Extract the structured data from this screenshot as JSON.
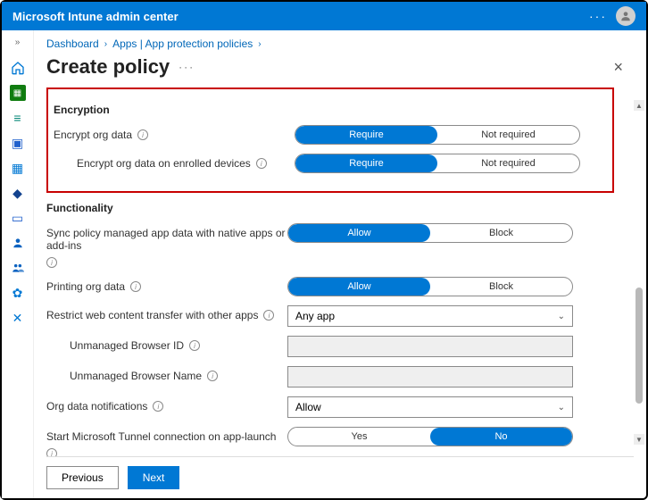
{
  "titlebar": {
    "title": "Microsoft Intune admin center"
  },
  "breadcrumbs": {
    "items": [
      "Dashboard",
      "Apps | App protection policies"
    ]
  },
  "page": {
    "title": "Create policy"
  },
  "sections": {
    "encryption": {
      "title": "Encryption",
      "encrypt_org": {
        "label": "Encrypt org data",
        "opt_on": "Require",
        "opt_off": "Not required"
      },
      "encrypt_enrolled": {
        "label": "Encrypt org data on enrolled devices",
        "opt_on": "Require",
        "opt_off": "Not required"
      }
    },
    "functionality": {
      "title": "Functionality",
      "sync": {
        "label": "Sync policy managed app data with native apps or add-ins",
        "opt_on": "Allow",
        "opt_off": "Block"
      },
      "printing": {
        "label": "Printing org data",
        "opt_on": "Allow",
        "opt_off": "Block"
      },
      "restrict_web": {
        "label": "Restrict web content transfer with other apps",
        "value": "Any app"
      },
      "browser_id": {
        "label": "Unmanaged Browser ID"
      },
      "browser_name": {
        "label": "Unmanaged Browser Name"
      },
      "notifications": {
        "label": "Org data notifications",
        "value": "Allow"
      },
      "tunnel": {
        "label": "Start Microsoft Tunnel connection on app-launch",
        "opt_on": "Yes",
        "opt_off": "No"
      }
    }
  },
  "footer": {
    "previous": "Previous",
    "next": "Next"
  }
}
